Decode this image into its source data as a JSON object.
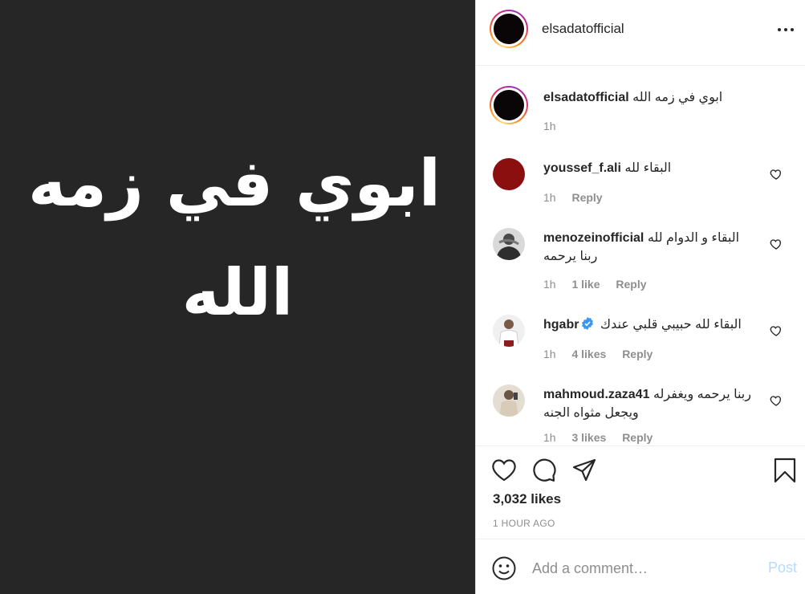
{
  "media": {
    "line1": "ابوي في زمه",
    "line2": "الله",
    "background": "#262626"
  },
  "post": {
    "username": "elsadatofficial",
    "more_icon": "more-horizontal-icon",
    "caption": {
      "username": "elsadatofficial",
      "text": "ابوي في زمه الله",
      "time": "1h"
    }
  },
  "comments": [
    {
      "username": "youssef_f.ali",
      "text": "البقاء لله",
      "time": "1h",
      "likes": "",
      "reply": "Reply",
      "verified": false
    },
    {
      "username": "menozeinofficial",
      "text": "البقاء و الدوام لله ربنا يرحمه",
      "time": "1h",
      "likes": "1 like",
      "reply": "Reply",
      "verified": false
    },
    {
      "username": "hgabr",
      "text": "البقاء لله حبيبي قلبي عندك",
      "time": "1h",
      "likes": "4 likes",
      "reply": "Reply",
      "verified": true
    },
    {
      "username": "mahmoud.zaza41",
      "text": "ربنا يرحمه ويغفرله ويجعل مثواه الجنه",
      "time": "1h",
      "likes": "3 likes",
      "reply": "Reply",
      "verified": false
    }
  ],
  "actions": {
    "like_icon": "heart-icon",
    "comment_icon": "comment-icon",
    "share_icon": "share-icon",
    "save_icon": "bookmark-icon",
    "likes_count": "3,032 likes",
    "time_ago": "1 HOUR AGO"
  },
  "add_comment": {
    "emoji_icon": "emoji-icon",
    "placeholder": "Add a comment…",
    "post_label": "Post",
    "post_color": "#b3dbff"
  },
  "colors": {
    "text": "#262626",
    "secondary": "#8e8e8e",
    "verified": "#3897f0",
    "link_disabled": "#b3dbff"
  }
}
